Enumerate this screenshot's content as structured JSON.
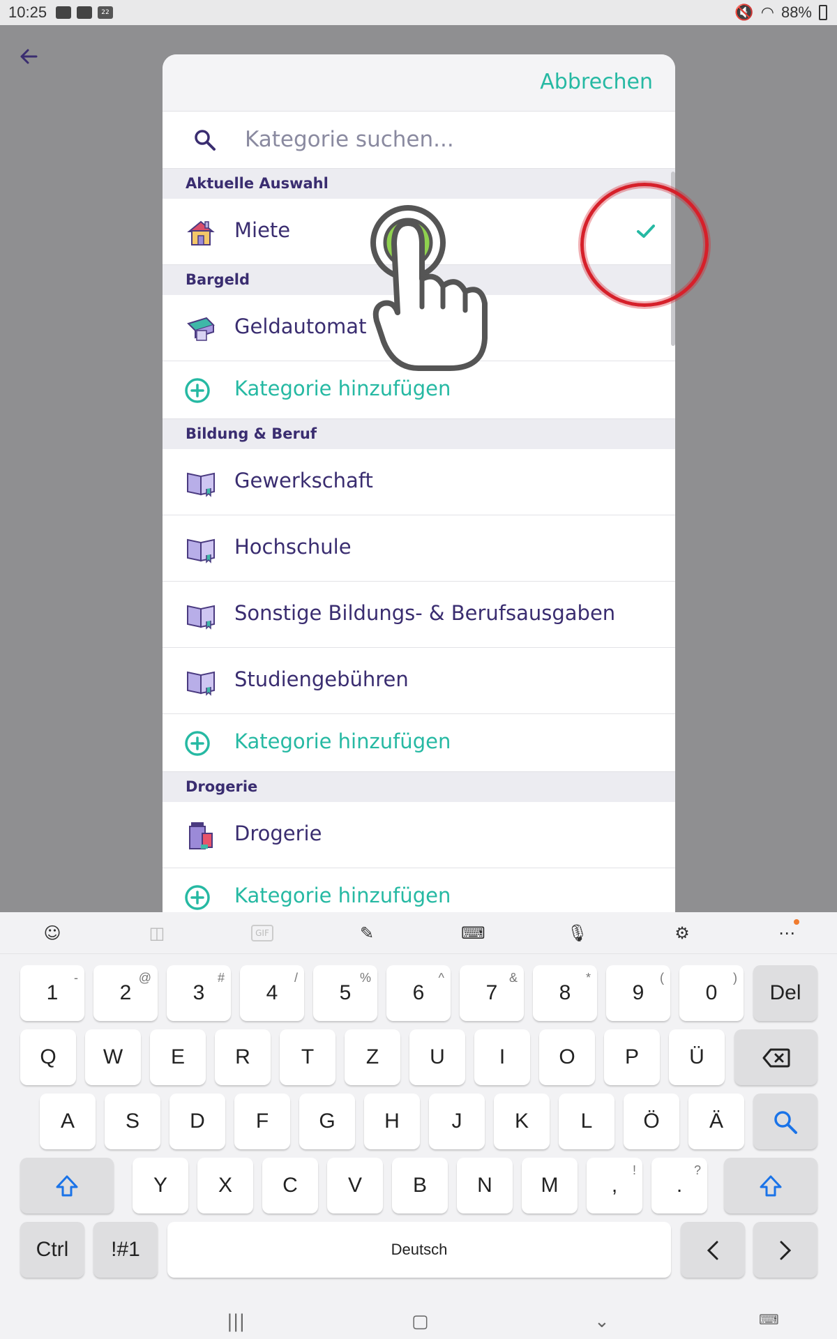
{
  "status_bar": {
    "time": "10:25",
    "calendar_day": "22",
    "battery": "88%"
  },
  "dialog": {
    "cancel_label": "Abbrechen",
    "search_placeholder": "Kategorie suchen...",
    "sections": [
      {
        "title": "Aktuelle Auswahl"
      },
      {
        "title": "Bargeld"
      },
      {
        "title": "Bildung & Beruf"
      },
      {
        "title": "Drogerie"
      }
    ],
    "rows": {
      "miete": {
        "label": "Miete",
        "icon": "house-icon",
        "selected": true
      },
      "geldautomat": {
        "label": "Geldautomat",
        "icon": "atm-icon"
      },
      "gewerkschaft": {
        "label": "Gewerkschaft",
        "icon": "book-icon"
      },
      "hochschule": {
        "label": "Hochschule",
        "icon": "book-icon"
      },
      "sonstige": {
        "label": "Sonstige Bildungs- & Berufsausgaben",
        "icon": "book-icon"
      },
      "studiengebuehren": {
        "label": "Studiengebühren",
        "icon": "book-icon"
      },
      "drogerie": {
        "label": "Drogerie",
        "icon": "drugstore-icon"
      }
    },
    "add_category_label": "Kategorie hinzufügen"
  },
  "keyboard": {
    "number_row": [
      {
        "k": "1",
        "s": "-"
      },
      {
        "k": "2",
        "s": "@"
      },
      {
        "k": "3",
        "s": "#"
      },
      {
        "k": "4",
        "s": "/"
      },
      {
        "k": "5",
        "s": "%"
      },
      {
        "k": "6",
        "s": "^"
      },
      {
        "k": "7",
        "s": "&"
      },
      {
        "k": "8",
        "s": "*"
      },
      {
        "k": "9",
        "s": "("
      },
      {
        "k": "0",
        "s": ")"
      }
    ],
    "del_label": "Del",
    "row_q": [
      "Q",
      "W",
      "E",
      "R",
      "T",
      "Z",
      "U",
      "I",
      "O",
      "P",
      "Ü"
    ],
    "row_a": [
      "A",
      "S",
      "D",
      "F",
      "G",
      "H",
      "J",
      "K",
      "L",
      "Ö",
      "Ä"
    ],
    "row_y": [
      "Y",
      "X",
      "C",
      "V",
      "B",
      "N",
      "M"
    ],
    "comma": ",",
    "comma_sup": "!",
    "period": ".",
    "period_sup": "?",
    "ctrl_label": "Ctrl",
    "sym_label": "!#1",
    "space_label": "Deutsch",
    "gif_label": "GIF"
  },
  "colors": {
    "accent": "#26b9a3",
    "text": "#3a2d70",
    "highlight_ring": "#d6202a"
  }
}
